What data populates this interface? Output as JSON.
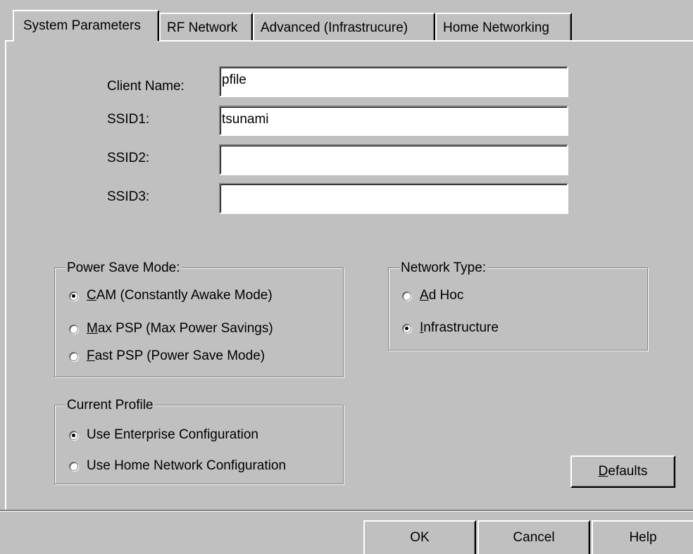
{
  "tabs": [
    {
      "label": "System Parameters"
    },
    {
      "label": "RF Network"
    },
    {
      "label": "Advanced (Infrastrucure)"
    },
    {
      "label": "Home Networking"
    }
  ],
  "fields": {
    "client_name": {
      "label": "Client Name:",
      "value": "pfile"
    },
    "ssid1": {
      "label": "SSID1:",
      "value": "tsunami"
    },
    "ssid2": {
      "label": "SSID2:",
      "value": ""
    },
    "ssid3": {
      "label": "SSID3:",
      "value": ""
    }
  },
  "power_save": {
    "title": "Power Save Mode:",
    "options": [
      {
        "key": "C",
        "rest": "AM (Constantly Awake Mode)",
        "selected": true
      },
      {
        "key": "M",
        "rest": "ax PSP (Max Power Savings)",
        "selected": false
      },
      {
        "key": "F",
        "rest": "ast PSP (Power Save Mode)",
        "selected": false
      }
    ]
  },
  "network_type": {
    "title": "Network Type:",
    "options": [
      {
        "key": "A",
        "rest": "d Hoc",
        "selected": false
      },
      {
        "key": "I",
        "rest": "nfrastructure",
        "selected": true
      }
    ]
  },
  "current_profile": {
    "title": "Current Profile",
    "options": [
      {
        "label": "Use Enterprise Configuration",
        "selected": true
      },
      {
        "label": "Use Home Network Configuration",
        "selected": false
      }
    ]
  },
  "defaults_button": {
    "key": "D",
    "rest": "efaults"
  },
  "footer": {
    "ok": "OK",
    "cancel": "Cancel",
    "help": "Help"
  }
}
